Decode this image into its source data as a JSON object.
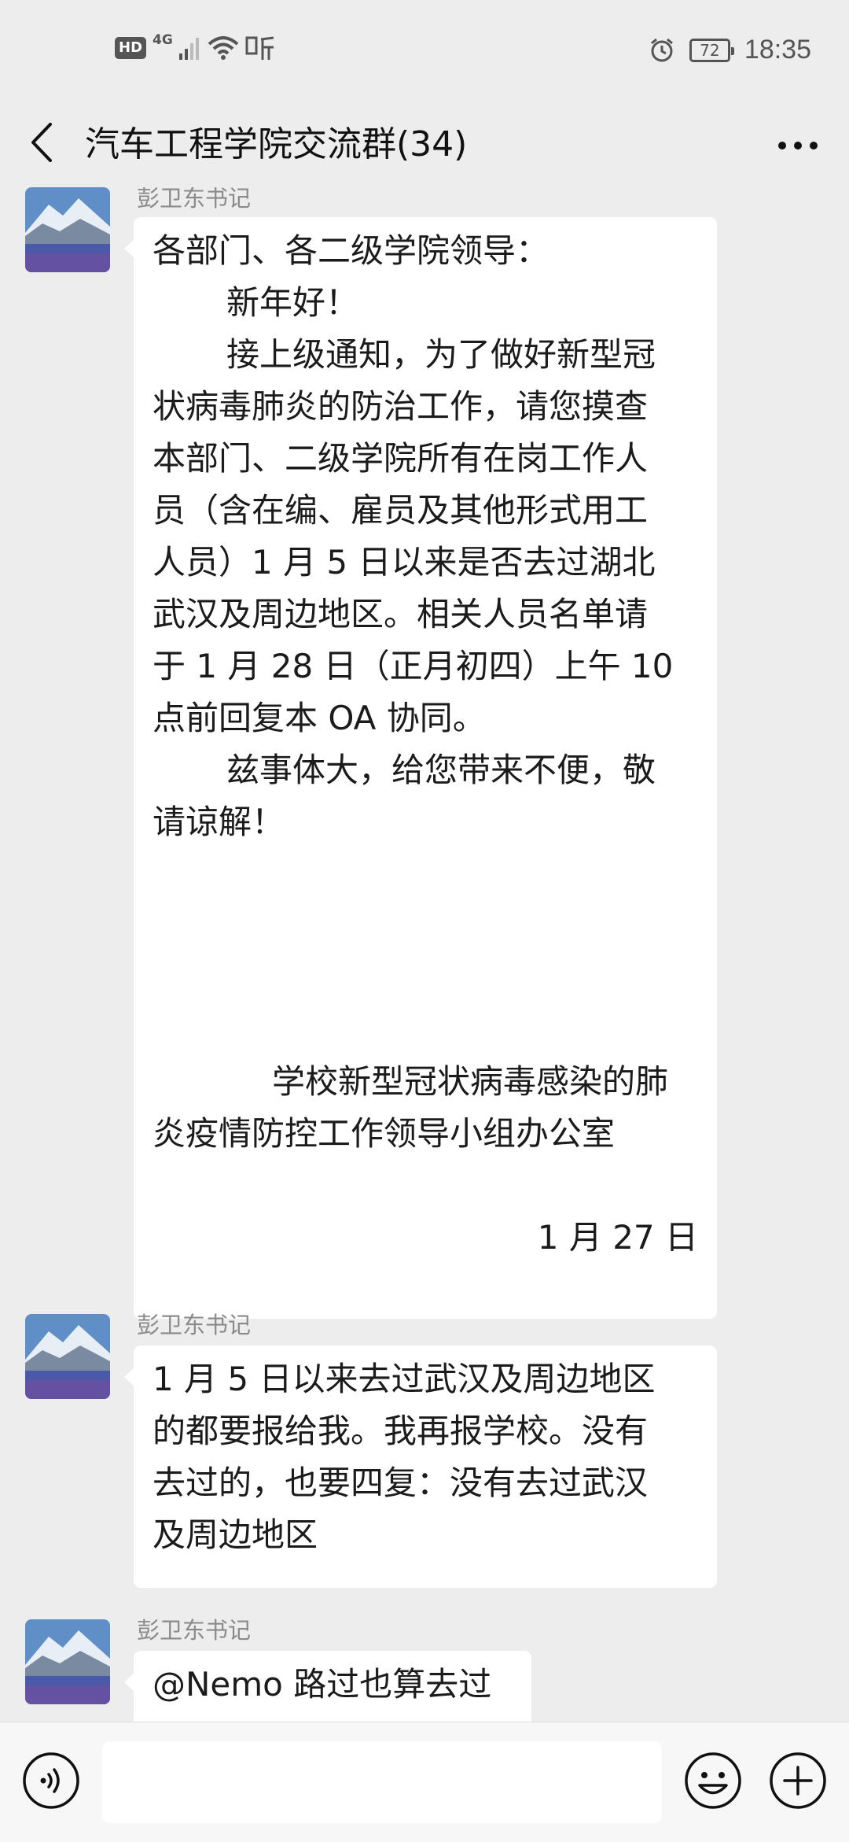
{
  "status_bar": {
    "hd": "HD",
    "network": "4G",
    "battery": "72",
    "time": "18:35"
  },
  "header": {
    "title": "汽车工程学院交流群(34)"
  },
  "messages": [
    {
      "sender": "彭卫东书记",
      "lines": [
        "各部门、各二级学院领导：",
        "新年好！",
        "接上级通知，为了做好新型冠",
        "状病毒肺炎的防治工作，请您摸查",
        "本部门、二级学院所有在岗工作人",
        "员（含在编、雇员及其他形式用工",
        "人员）1 月 5 日以来是否去过湖北",
        "武汉及周边地区。相关人员名单请",
        "于 1 月 28 日（正月初四）上午 10",
        "点前回复本 OA 协同。",
        "兹事体大，给您带来不便，敬",
        "请谅解！",
        "学校新型冠状病毒感染的肺",
        "炎疫情防控工作领导小组办公室",
        "1 月 27 日"
      ]
    },
    {
      "sender": "彭卫东书记",
      "lines": [
        "1 月 5 日以来去过武汉及周边地区",
        "的都要报给我。我再报学校。没有",
        "去过的，也要四复：没有去过武汉",
        "及周边地区"
      ]
    },
    {
      "sender": "彭卫东书记",
      "lines": [
        "@Nemo  路过也算去过"
      ]
    }
  ],
  "input": {
    "value": ""
  },
  "colors": {
    "background": "#ededed",
    "bubble": "#ffffff",
    "sender_name": "#8a8a8a"
  }
}
